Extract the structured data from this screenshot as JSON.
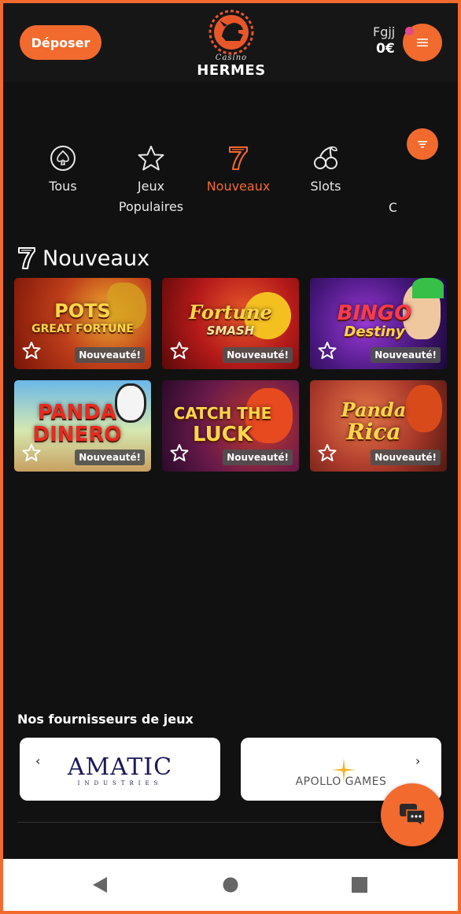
{
  "header": {
    "deposit_label": "Déposer",
    "logo_casino": "Casino",
    "logo_name": "HERMES",
    "user_name": "Fgjj",
    "balance": "0€"
  },
  "categories": [
    {
      "label": "Tous",
      "icon": "spade-icon"
    },
    {
      "label": "Jeux Populaires",
      "icon": "star-icon"
    },
    {
      "label": "Nouveaux",
      "icon": "seven-icon",
      "active": true
    },
    {
      "label": "Slots",
      "icon": "cherries-icon"
    },
    {
      "label": "C",
      "icon": "none"
    }
  ],
  "section": {
    "title": "Nouveaux",
    "icon": "seven-icon"
  },
  "games": [
    {
      "title_line1": "POTS",
      "title_line2": "GREAT FORTUNE",
      "badge": "Nouveauté!"
    },
    {
      "title_line1": "Fortune",
      "title_line2": "SMASH",
      "badge": "Nouveauté!"
    },
    {
      "title_line1": "BINGO",
      "title_line2": "Destiny",
      "badge": "Nouveauté!"
    },
    {
      "title_line1": "PANDA",
      "title_line2": "DINERO",
      "badge": "Nouveauté!"
    },
    {
      "title_line1": "CATCH THE",
      "title_line2": "LUCK",
      "badge": "Nouveauté!"
    },
    {
      "title_line1": "Panda",
      "title_line2": "Rica",
      "badge": "Nouveauté!"
    }
  ],
  "providers": {
    "title": "Nos fournisseurs de jeux",
    "items": [
      {
        "name": "AMATIC",
        "sub": "INDUSTRIES"
      },
      {
        "name": "APOLLO GAMES"
      }
    ]
  },
  "colors": {
    "accent": "#f26a2e",
    "background": "#111111",
    "notification": "#e04a8a"
  }
}
